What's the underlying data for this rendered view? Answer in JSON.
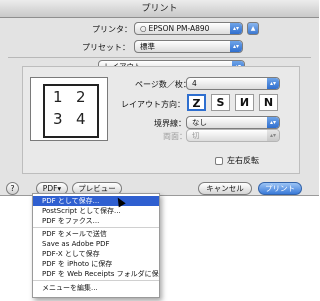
{
  "window": {
    "title": "プリント"
  },
  "printer": {
    "label": "プリンタ：",
    "value": "EPSON PM-A890",
    "status_glyph": "○"
  },
  "preset": {
    "label": "プリセット：",
    "value": "標準"
  },
  "panel_selector": {
    "value": "レイアウト"
  },
  "layout": {
    "pages_per_sheet": {
      "label": "ページ数／枚：",
      "value": "4"
    },
    "direction": {
      "label": "レイアウト方向：",
      "options": [
        "Z",
        "S",
        "И",
        "N"
      ]
    },
    "border": {
      "label": "境界線：",
      "value": "なし"
    },
    "two_sided": {
      "label": "両面：",
      "value": "切"
    },
    "flip": {
      "label": "左右反転"
    },
    "preview_pages": [
      "1",
      "2",
      "3",
      "4"
    ]
  },
  "footer": {
    "help": "?",
    "pdf_button": "PDF▾",
    "preview_button": "プレビュー",
    "cancel_button": "キャンセル",
    "print_button": "プリント"
  },
  "pdf_menu": {
    "group1": [
      "PDF として保存...",
      "PostScript として保存...",
      "PDF をファクス..."
    ],
    "group2": [
      "PDF をメールで送信",
      "Save as Adobe PDF",
      "PDF-X として保存",
      "PDF を iPhoto に保存",
      "PDF を Web Receipts フォルダに保存"
    ],
    "group3": [
      "メニューを編集..."
    ],
    "highlighted_index": 0
  },
  "colors": {
    "accent": "#2f6fcf",
    "menu_highlight": "#2f5fd0"
  }
}
